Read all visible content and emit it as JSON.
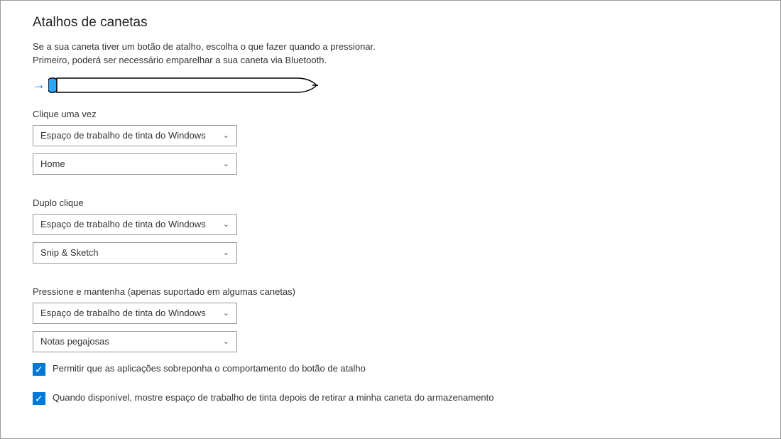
{
  "title": "Atalhos de canetas",
  "description": "Se a sua caneta tiver um botão de atalho, escolha o que fazer quando a pressionar. Primeiro, poderá ser necessário emparelhar a sua caneta via Bluetooth.",
  "click_once": {
    "label": "Clique uma vez",
    "option1": "Espaço de trabalho de tinta do Windows",
    "option2": "Home"
  },
  "double_click": {
    "label": "Duplo clique",
    "option1": "Espaço de trabalho de tinta do Windows",
    "option2": "Snip & Sketch"
  },
  "press_hold": {
    "label": "Pressione e mantenha (apenas suportado em algumas canetas)",
    "option1": "Espaço de trabalho de tinta do Windows",
    "option2": "Notas pegajosas"
  },
  "checkbox1": {
    "label": "Permitir que as aplicações sobreponha o comportamento do botão de atalho",
    "checked": true
  },
  "checkbox2": {
    "label": "Quando disponível, mostre espaço de trabalho de tinta depois de retirar a minha caneta do armazenamento",
    "checked": true
  }
}
